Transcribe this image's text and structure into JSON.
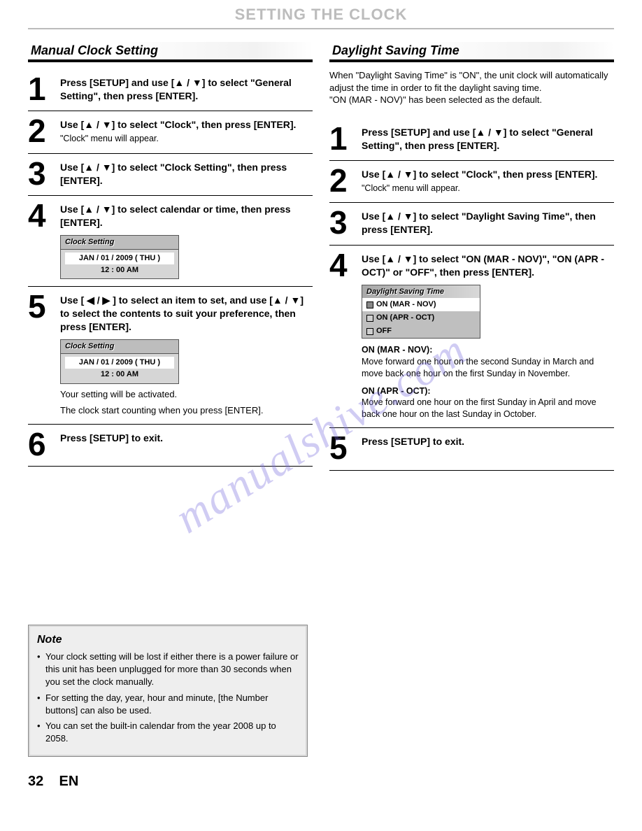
{
  "header": "SETTING THE CLOCK",
  "watermark": "manualshive.com",
  "left": {
    "title": "Manual Clock Setting",
    "steps": [
      {
        "n": "1",
        "main": "Press [SETUP] and use [▲ / ▼] to select \"General Setting\", then press [ENTER]."
      },
      {
        "n": "2",
        "main": "Use [▲ / ▼] to select \"Clock\", then press [ENTER].",
        "sub": "\"Clock\" menu will appear."
      },
      {
        "n": "3",
        "main": "Use [▲ / ▼] to select \"Clock Setting\", then press [ENTER]."
      },
      {
        "n": "4",
        "main": "Use [▲ / ▼] to select calendar or time, then press [ENTER].",
        "ui": {
          "title": "Clock Setting",
          "date": "JAN / 01 / 2009 ( THU )",
          "time": "12 : 00 AM"
        }
      },
      {
        "n": "5",
        "main": "Use [ ◀ / ▶ ] to select an item to set, and use [▲ / ▼] to select the contents to suit your preference, then press [ENTER].",
        "ui": {
          "title": "Clock Setting",
          "date": "JAN / 01 / 2009 ( THU )",
          "time": "12 : 00 AM"
        },
        "after1": "Your setting will be activated.",
        "after2": "The clock start counting when you press [ENTER]."
      },
      {
        "n": "6",
        "main": "Press [SETUP] to exit."
      }
    ]
  },
  "right": {
    "title": "Daylight Saving Time",
    "intro1": "When \"Daylight Saving Time\" is \"ON\", the unit clock will automatically adjust the time in order to fit the daylight saving time.",
    "intro2": "\"ON (MAR - NOV)\" has been selected as the default.",
    "steps": [
      {
        "n": "1",
        "main": "Press [SETUP] and use [▲ / ▼] to select \"General Setting\", then press [ENTER]."
      },
      {
        "n": "2",
        "main": "Use [▲ / ▼] to select \"Clock\", then press [ENTER].",
        "sub": "\"Clock\" menu will appear."
      },
      {
        "n": "3",
        "main": "Use [▲ / ▼] to select \"Daylight Saving Time\", then press [ENTER]."
      },
      {
        "n": "4",
        "main": "Use [▲ / ▼] to select \"ON (MAR - NOV)\", \"ON (APR - OCT)\" or \"OFF\", then press [ENTER].",
        "dst": {
          "title": "Daylight Saving Time",
          "opts": [
            "ON (MAR - NOV)",
            "ON (APR - OCT)",
            "OFF"
          ]
        },
        "explain": [
          {
            "h": "ON (MAR - NOV):",
            "t": "Move forward one hour on the second Sunday in March and move back one hour on the first Sunday in November."
          },
          {
            "h": "ON (APR - OCT):",
            "t": "Move forward one hour on the first Sunday in April and move back one hour on the last Sunday in October."
          }
        ]
      },
      {
        "n": "5",
        "main": "Press [SETUP] to exit."
      }
    ]
  },
  "note": {
    "title": "Note",
    "items": [
      "Your clock setting will be lost if either there is a power failure or this unit has been unplugged for more than 30 seconds when you set the clock manually.",
      "For setting the day, year, hour and minute, [the Number buttons] can also be used.",
      "You can set the built-in calendar from the year 2008 up to 2058."
    ]
  },
  "footer": {
    "page": "32",
    "lang": "EN"
  }
}
